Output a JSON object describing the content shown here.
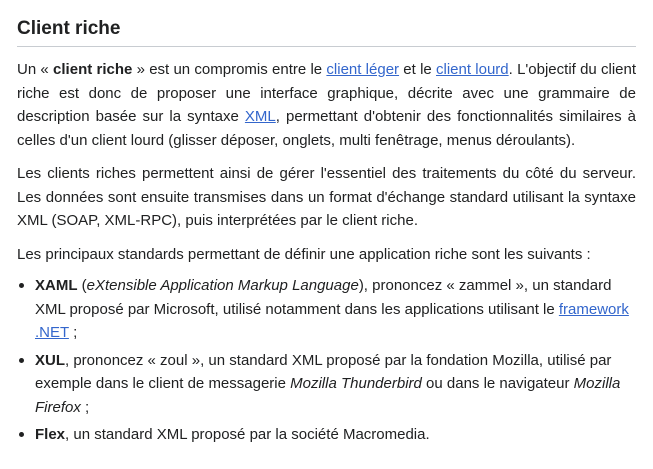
{
  "heading": "Client riche",
  "p1": {
    "t1": "Un « ",
    "b1": "client riche",
    "t2": " » est un compromis entre le ",
    "link1": "client léger",
    "t3": " et le ",
    "link2": "client lourd",
    "t4": ". L'objectif du client riche est donc de proposer une interface graphique, décrite avec une grammaire de description basée sur la syntaxe ",
    "link3": "XML",
    "t5": ", permettant d'obtenir des fonctionnalités similaires à celles d'un client lourd (glisser déposer, onglets, multi fenêtrage, menus déroulants)."
  },
  "p2": "Les clients riches permettent ainsi de gérer l'essentiel des traitements du côté du serveur. Les données sont ensuite transmises dans un format d'échange standard utilisant la syntaxe XML (SOAP, XML-RPC), puis interprétées par le client riche.",
  "p3": "Les principaux standards permettant de définir une application riche sont les suivants :",
  "list": [
    {
      "b": "XAML",
      "t1": " (",
      "i1": "eXtensible Application Markup Language",
      "t2": "), prononcez « zammel », un standard XML proposé par Microsoft, utilisé notamment dans les applications utilisant le ",
      "link": "framework .NET",
      "t3": " ;"
    },
    {
      "b": "XUL",
      "t1": ", prononcez « zoul », un standard XML proposé par la fondation Mozilla, utilisé par exemple dans le client de messagerie ",
      "i1": "Mozilla Thunderbird",
      "t2": " ou dans le navigateur ",
      "i2": "Mozilla Firefox",
      "t3": " ;"
    },
    {
      "b": "Flex",
      "t1": ", un standard XML proposé par la société Macromedia."
    }
  ]
}
